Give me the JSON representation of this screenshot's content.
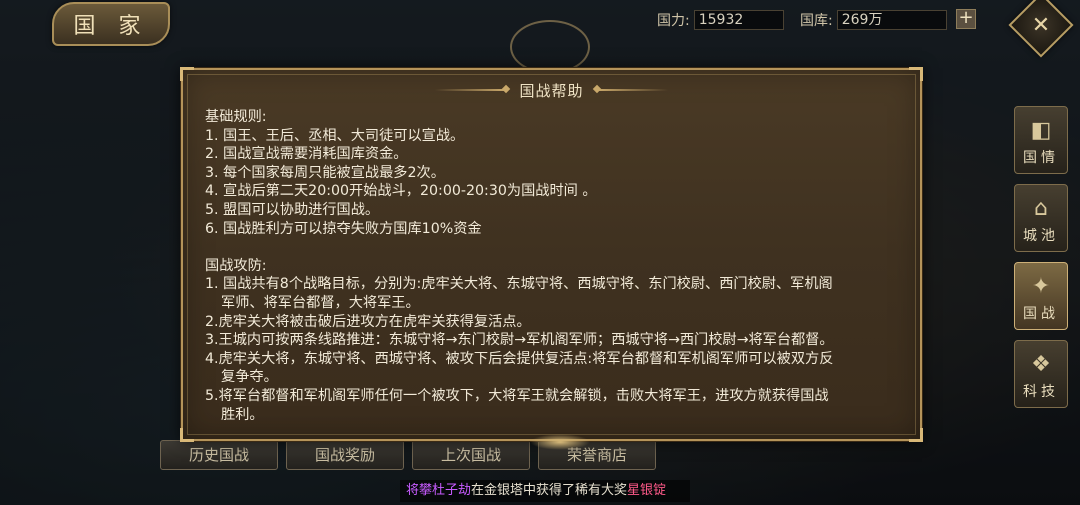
{
  "header": {
    "title": "国 家",
    "power_label": "国力:",
    "power_value": "15932",
    "treasury_label": "国库:",
    "treasury_value": "269万",
    "plus_label": "+",
    "close_glyph": "✕"
  },
  "side_menu": {
    "items": [
      {
        "label": "国情",
        "glyph": "◧",
        "active": false
      },
      {
        "label": "城池",
        "glyph": "⌂",
        "active": false
      },
      {
        "label": "国战",
        "glyph": "✦",
        "active": true
      },
      {
        "label": "科技",
        "glyph": "❖",
        "active": false
      }
    ]
  },
  "bottom_tabs": [
    "历史国战",
    "国战奖励",
    "上次国战",
    "荣誉商店"
  ],
  "marquee": {
    "player": "将攀杜子劫",
    "middle": "在金银塔中获得了稀有大奖",
    "prize": "星银锭"
  },
  "modal": {
    "title": "国战帮助",
    "basic_heading": "基础规则:",
    "basic_rules": [
      "1. 国王、王后、丞相、大司徒可以宣战。",
      "2. 国战宣战需要消耗国库资金。",
      "3. 每个国家每周只能被宣战最多2次。",
      "4. 宣战后第二天20:00开始战斗，20:00-20:30为国战时间 。",
      "5. 盟国可以协助进行国战。",
      "6. 国战胜利方可以掠夺失败方国库10%资金"
    ],
    "attack_heading": "国战攻防:",
    "attack_rules": [
      {
        "line1": "1. 国战共有8个战略目标，分别为:虎牢关大将、东城守将、西城守将、东门校尉、西门校尉、军机阁",
        "line2": "军师、将军台都督，大将军王。"
      },
      {
        "line1": "2.虎牢关大将被击破后进攻方在虎牢关获得复活点。",
        "line2": ""
      },
      {
        "line1": "3.王城内可按两条线路推进：东城守将→东门校尉→军机阁军师；西城守将→西门校尉→将军台都督。",
        "line2": ""
      },
      {
        "line1": "4.虎牢关大将，东城守将、西城守将、被攻下后会提供复活点:将军台都督和军机阁军师可以被双方反",
        "line2": "复争夺。"
      },
      {
        "line1": "5.将军台都督和军机阁军师任何一个被攻下，大将军王就会解锁，击败大将军王，进攻方就获得国战",
        "line2": "胜利。"
      }
    ]
  }
}
